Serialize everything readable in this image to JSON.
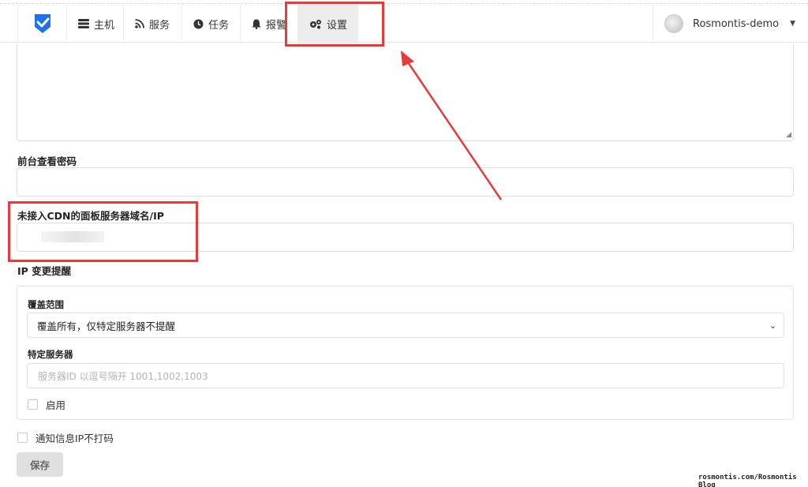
{
  "nav": {
    "items": [
      {
        "label": "主机",
        "icon": "server-icon"
      },
      {
        "label": "服务",
        "icon": "rss-icon"
      },
      {
        "label": "任务",
        "icon": "clock-icon"
      },
      {
        "label": "报警",
        "icon": "bell-icon"
      },
      {
        "label": "设置",
        "icon": "gears-icon",
        "active": true
      }
    ],
    "user": {
      "name": "Rosmontis-demo"
    }
  },
  "form": {
    "frontend_password_label": "前台查看密码",
    "frontend_password_value": "",
    "panel_domain_label": "未接入CDN的面板服务器域名/IP",
    "ip_change_title": "IP 变更提醒",
    "coverage_label": "覆盖范围",
    "coverage_selected": "覆盖所有，仅特定服务器不提醒",
    "specific_servers_label": "特定服务器",
    "specific_servers_placeholder": "服务器ID 以逗号隔开 1001,1002,1003",
    "enable_label": "启用",
    "no_mask_label": "通知信息IP不打码",
    "save_label": "保存"
  },
  "watermark": "rosmontis.com/Rosmontis Blog",
  "colors": {
    "brand": "#1e73e8",
    "annotation": "#e83a3a",
    "active_nav_bg": "#ededed"
  }
}
